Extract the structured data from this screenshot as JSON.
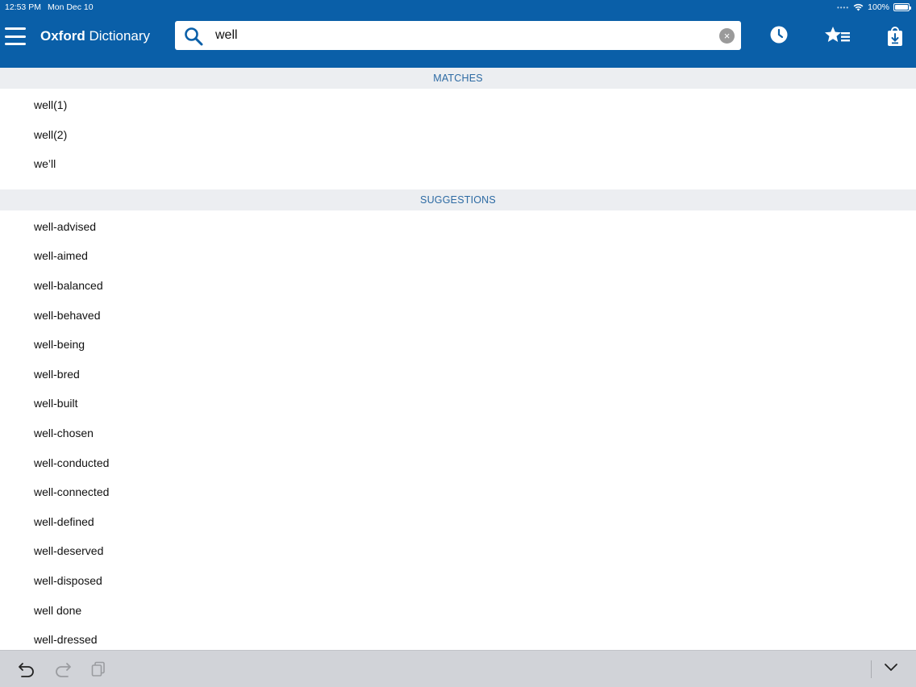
{
  "status_bar": {
    "time": "12:53 PM",
    "date": "Mon Dec 10",
    "battery": "100%",
    "battery_level": 1.0
  },
  "header": {
    "brand_bold": "Oxford",
    "brand_light": "Dictionary",
    "menu_icon": "hamburger-menu-icon",
    "history_icon": "clock-icon",
    "favorites_icon": "star-list-icon",
    "downloads_icon": "download-bag-icon"
  },
  "search": {
    "value": "well",
    "placeholder": "",
    "clear_glyph": "×"
  },
  "matches": {
    "header": "MATCHES",
    "items": [
      "well(1)",
      "well(2)",
      "we’ll"
    ]
  },
  "suggestions": {
    "header": "SUGGESTIONS",
    "items": [
      "well-advised",
      "well-aimed",
      "well-balanced",
      "well-behaved",
      "well-being",
      "well-bred",
      "well-built",
      "well-chosen",
      "well-conducted",
      "well-connected",
      "well-defined",
      "well-deserved",
      "well-disposed",
      "well done",
      "well-dressed"
    ]
  },
  "keyboard_bar": {
    "undo_icon": "undo-icon",
    "redo_icon": "redo-icon",
    "paste_icon": "paste-icon",
    "dismiss_icon": "chevron-down-icon"
  },
  "colors": {
    "header_blue": "#0a5fa8",
    "section_bg": "#eceef1",
    "section_text": "#2c6aa3",
    "keyboard_bar": "#d1d3d8"
  }
}
